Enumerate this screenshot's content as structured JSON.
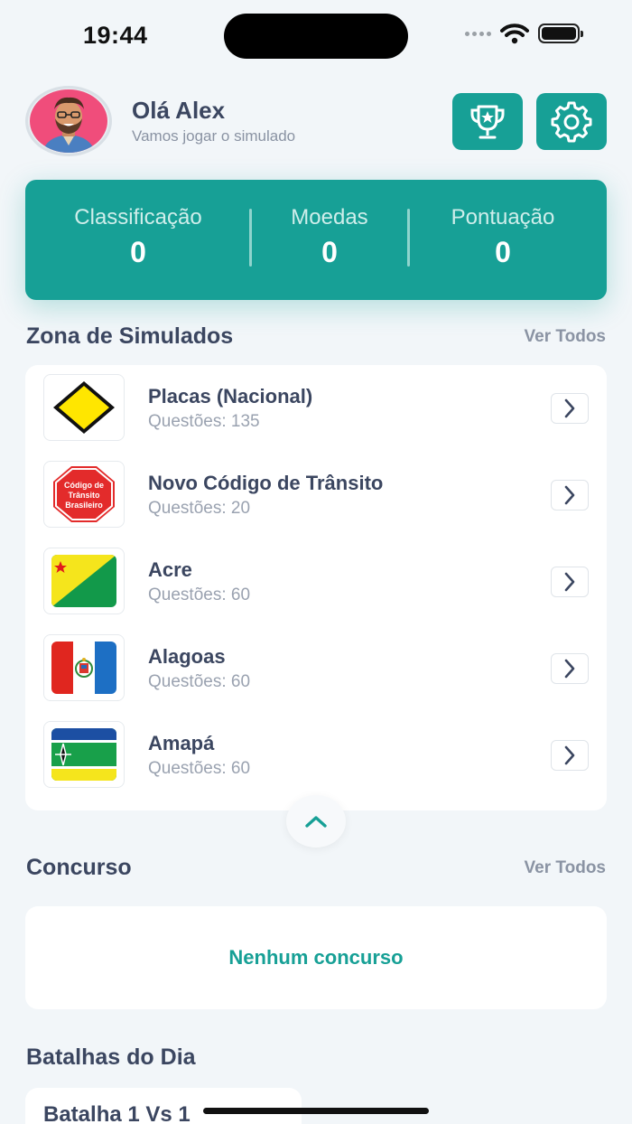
{
  "status_bar": {
    "time": "19:44"
  },
  "header": {
    "greeting": "Olá Alex",
    "subtitle": "Vamos jogar o simulado",
    "trophy_icon": "trophy-icon",
    "settings_icon": "gear-icon"
  },
  "stats": [
    {
      "label": "Classificação",
      "value": "0"
    },
    {
      "label": "Moedas",
      "value": "0"
    },
    {
      "label": "Pontuação",
      "value": "0"
    }
  ],
  "simulados": {
    "title": "Zona de Simulados",
    "see_all": "Ver Todos",
    "items": [
      {
        "title": "Placas (Nacional)",
        "subtitle": "Questões: 135",
        "icon": "warning-sign-icon"
      },
      {
        "title": "Novo Código de Trânsito",
        "subtitle": "Questões: 20",
        "icon": "stop-sign-icon",
        "icon_text": [
          "Código de",
          "Trânsito",
          "Brasileiro"
        ]
      },
      {
        "title": "Acre",
        "subtitle": "Questões: 60",
        "icon": "acre-flag-icon"
      },
      {
        "title": "Alagoas",
        "subtitle": "Questões: 60",
        "icon": "alagoas-flag-icon"
      },
      {
        "title": "Amapá",
        "subtitle": "Questões: 60",
        "icon": "amapa-flag-icon"
      }
    ]
  },
  "concurso": {
    "title": "Concurso",
    "see_all": "Ver Todos",
    "empty_text": "Nenhum concurso"
  },
  "batalhas": {
    "title": "Batalhas do Dia",
    "first_card_title": "Batalha 1 Vs 1"
  },
  "colors": {
    "accent": "#17a096",
    "background": "#f2f6f9",
    "text": "#3b4660",
    "muted": "#8a93a3"
  }
}
